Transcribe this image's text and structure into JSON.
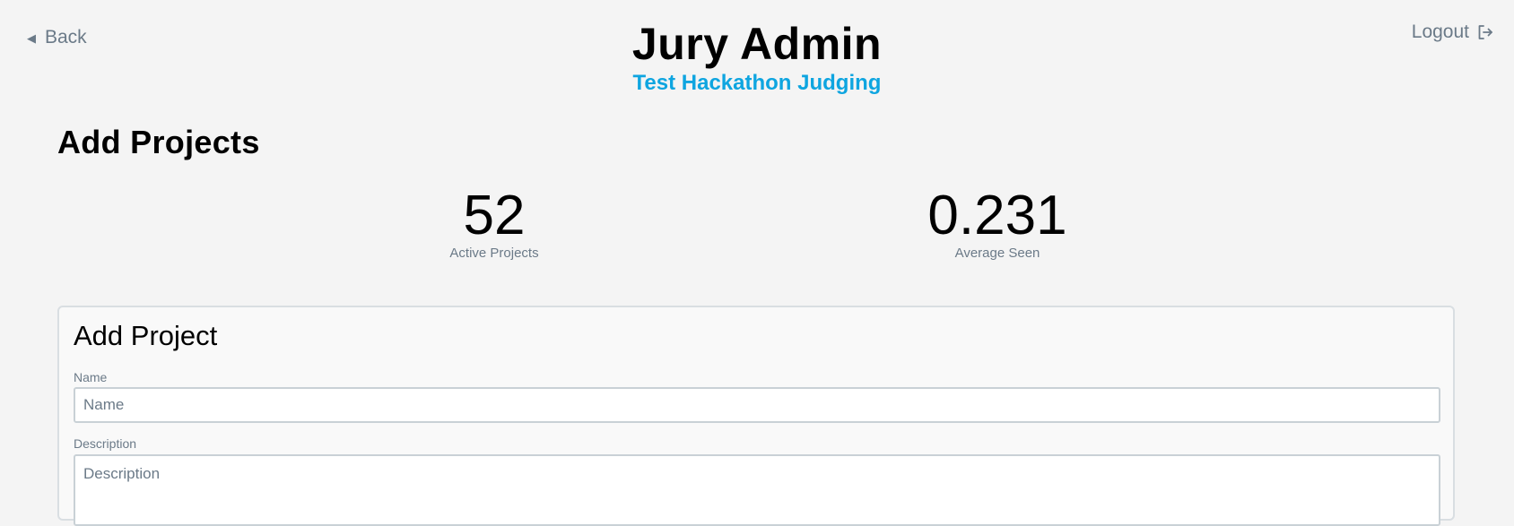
{
  "header": {
    "back_label": "Back",
    "title": "Jury Admin",
    "subtitle": "Test Hackathon Judging",
    "logout_label": "Logout"
  },
  "section": {
    "title": "Add Projects"
  },
  "stats": [
    {
      "value": "52",
      "label": "Active Projects"
    },
    {
      "value": "0.231",
      "label": "Average Seen"
    }
  ],
  "form": {
    "title": "Add Project",
    "name_label": "Name",
    "name_placeholder": "Name",
    "description_label": "Description",
    "description_placeholder": "Description"
  },
  "colors": {
    "background": "#f4f4f4",
    "accent": "#0ea5e0",
    "muted_text": "#6b7a88"
  },
  "icons": {
    "back": "back-triangle-icon",
    "logout": "logout-icon"
  }
}
